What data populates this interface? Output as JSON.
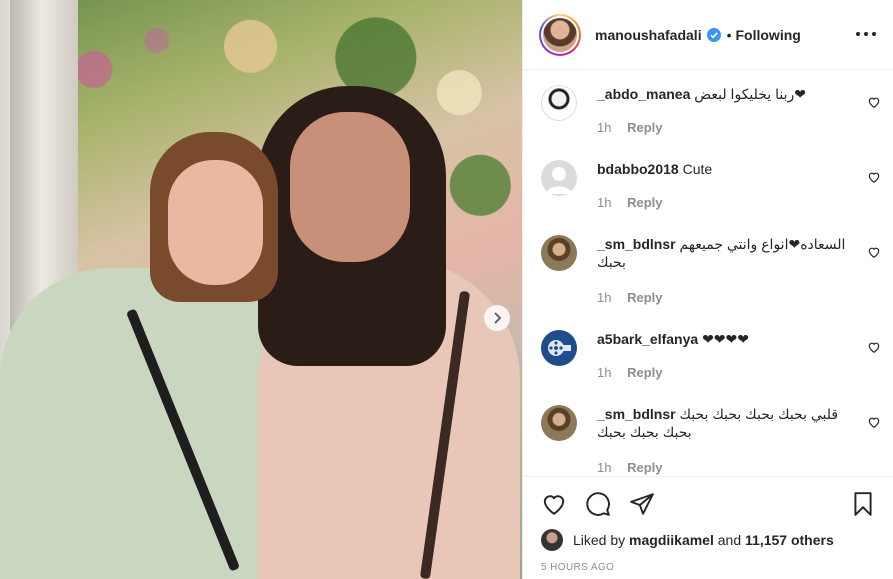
{
  "post": {
    "author": "manoushafadali",
    "separator": "•",
    "follow_status": "Following",
    "verified": true
  },
  "comments": [
    {
      "user": "_abdo_manea",
      "text": "ربنا يخليكوا لبعض❤",
      "time": "1h",
      "reply": "Reply",
      "avatar_icon": "person-sketch-icon"
    },
    {
      "user": "bdabbo2018",
      "text": "Cute",
      "time": "1h",
      "reply": "Reply",
      "avatar_icon": "default-avatar-icon"
    },
    {
      "user": "_sm_bdlnsr",
      "text": "السعاده❤انواع وانتي جميعهم بحبك",
      "time": "1h",
      "reply": "Reply",
      "avatar_icon": "person-photo-icon"
    },
    {
      "user": "a5bark_elfanya",
      "text": "❤❤❤❤",
      "time": "1h",
      "reply": "Reply",
      "avatar_icon": "film-reel-icon"
    },
    {
      "user": "_sm_bdlnsr",
      "text": "قلبي بحبك بحبك بحبك بحبك بحبك بحبك بحبك",
      "time": "1h",
      "reply": "Reply",
      "avatar_icon": "person-photo-icon"
    }
  ],
  "likes": {
    "prefix": "Liked by",
    "user": "magdiikamel",
    "connector": "and",
    "others": "11,157 others"
  },
  "timestamp": "5 HOURS AGO",
  "colors": {
    "text": "#262626",
    "muted": "#8e8e8e",
    "border": "#efefef",
    "verified": "#3897f0"
  }
}
